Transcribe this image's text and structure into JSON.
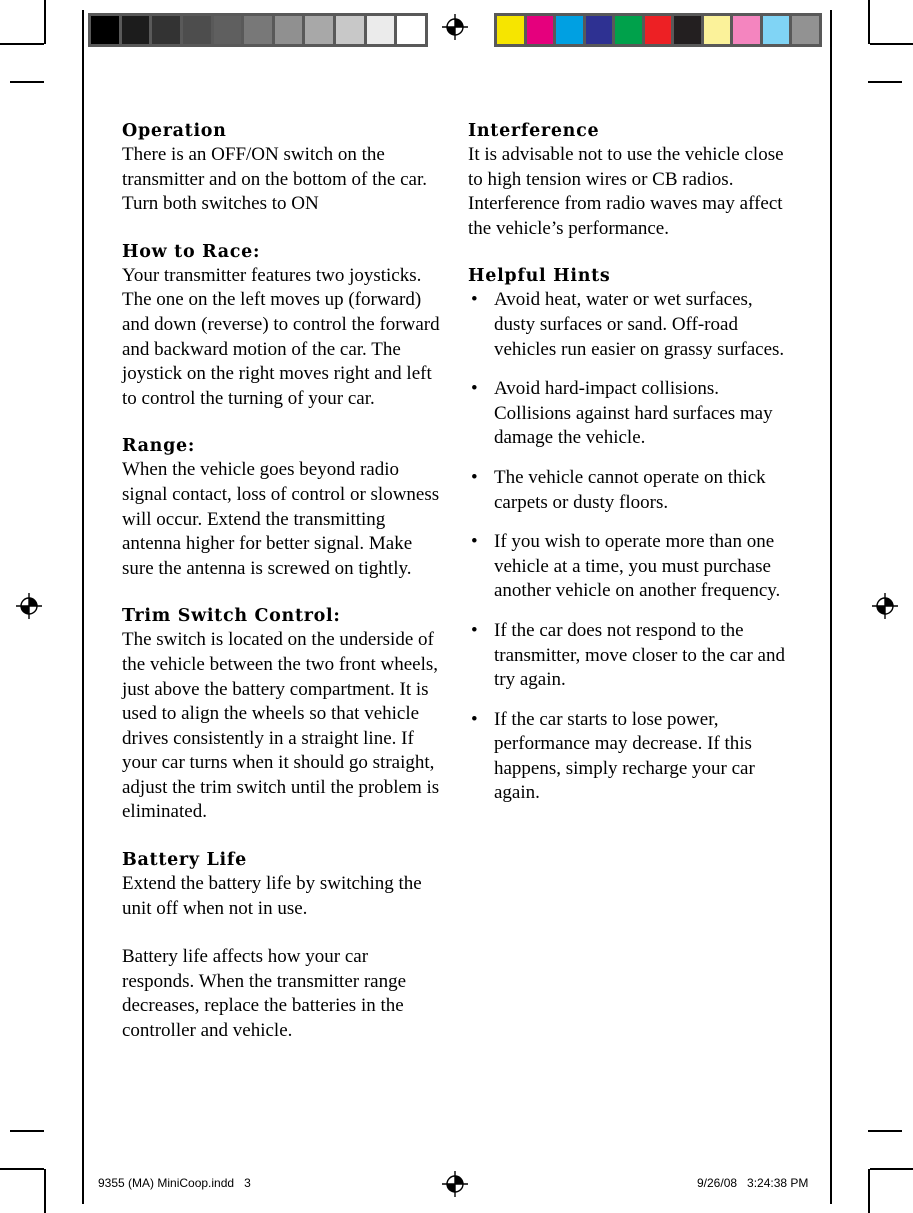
{
  "document": {
    "page_number_slug": "9355 (MA) MiniCoop.indd   3",
    "timestamp_slug": "9/26/08   3:24:38 PM"
  },
  "calibration": {
    "gray_strip": {
      "name": "grayscale-step-wedge",
      "frame_color": "#595959",
      "swatches": [
        "#000000",
        "#1c1c1c",
        "#333333",
        "#4d4d4d",
        "#5f5f5f",
        "#787878",
        "#909090",
        "#a8a8a8",
        "#c8c8c8",
        "#ebebeb",
        "#ffffff"
      ]
    },
    "color_strip": {
      "name": "process-color-bar",
      "frame_color": "#595959",
      "swatches": [
        "#f6e500",
        "#e5007d",
        "#00a0e2",
        "#2e3192",
        "#00a14b",
        "#ed2024",
        "#231f20",
        "#fbf29a",
        "#f485bf",
        "#80d4f5",
        "#929292"
      ]
    }
  },
  "left_column": [
    {
      "heading": "Operation",
      "paragraphs": [
        "There is an OFF/ON switch on the transmitter and on the bottom of the car. Turn both switches to ON"
      ]
    },
    {
      "heading": "How to Race:",
      "paragraphs": [
        "Your transmitter features two joysticks. The one on the left moves up (forward) and down (reverse) to control the forward and backward motion of the car. The joystick on the right moves right and left to control the turning of your car."
      ]
    },
    {
      "heading": "Range:",
      "paragraphs": [
        "When the vehicle goes beyond radio signal contact, loss of control or slowness will occur. Extend the transmitting antenna higher for better signal. Make sure the antenna is screwed on tightly."
      ]
    },
    {
      "heading": "Trim Switch Control:",
      "paragraphs": [
        "The switch is located on the underside of the vehicle between the two front wheels, just above the battery compartment. It is used to align the wheels so that vehicle drives consistently in a straight line. If your car turns when it should go straight, adjust the trim switch until the problem is eliminated."
      ]
    },
    {
      "heading": "Battery Life",
      "paragraphs": [
        "Extend the battery life by switching the unit off when not in use.",
        "Battery life affects how your car responds. When the transmitter range decreases, replace the batteries in the controller and vehicle."
      ]
    }
  ],
  "right_column": {
    "interference": {
      "heading": "Interference",
      "paragraphs": [
        "It is advisable not to use the vehicle close to high tension wires or CB radios. Interference from radio waves may affect the vehicle’s performance."
      ]
    },
    "helpful_hints": {
      "heading": "Helpful Hints",
      "bullet_glyph": "•",
      "items": [
        "Avoid heat, water or wet surfaces, dusty surfaces or sand. Off-road vehicles run easier on grassy surfaces.",
        "Avoid hard-impact collisions. Collisions against hard surfaces may damage the vehicle.",
        "The vehicle cannot operate on thick carpets or dusty floors.",
        "If you wish to operate more than one vehicle at a time, you must purchase another vehicle on another frequency.",
        "If the car does not respond to the transmitter, move closer to the car and try again.",
        "If the car starts to lose power, performance may decrease.  If this happens, simply recharge your car again."
      ]
    }
  }
}
